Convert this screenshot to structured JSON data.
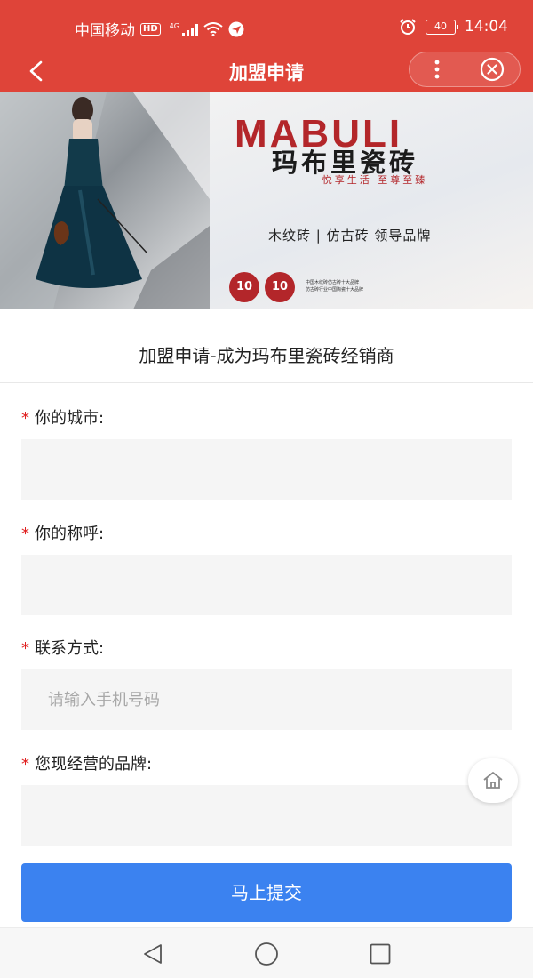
{
  "status_bar": {
    "carrier": "中国移动",
    "hd": "HD",
    "network": "4G",
    "battery": "40",
    "time": "14:04"
  },
  "nav": {
    "title": "加盟申请"
  },
  "banner": {
    "brand_en": "MABULI",
    "brand_cn": "玛布里瓷砖",
    "slogan": "悦享生活 至尊至臻",
    "tagline": "木纹砖 | 仿古砖 领导品牌",
    "award_badges": [
      "10",
      "10"
    ],
    "award_lines": [
      "中国木纹砖仿古砖十大品牌",
      "仿古砖行业中国陶瓷十大品牌"
    ]
  },
  "form": {
    "heading": "加盟申请-成为玛布里瓷砖经销商",
    "required_mark": "*",
    "fields": [
      {
        "label": "你的城市:",
        "placeholder": ""
      },
      {
        "label": "你的称呼:",
        "placeholder": ""
      },
      {
        "label": "联系方式:",
        "placeholder": "请输入手机号码"
      },
      {
        "label": "您现经营的品牌:",
        "placeholder": ""
      }
    ],
    "submit_label": "马上提交"
  },
  "colors": {
    "header_red": "#df4439",
    "required_red": "#e02020",
    "submit_blue": "#3b82f0",
    "input_bg": "#f5f5f5"
  },
  "icons": [
    "back-icon",
    "more-icon",
    "close-circle-icon",
    "home-icon",
    "nav-back-icon",
    "nav-home-icon",
    "nav-recents-icon",
    "wifi-icon",
    "alarm-icon"
  ]
}
